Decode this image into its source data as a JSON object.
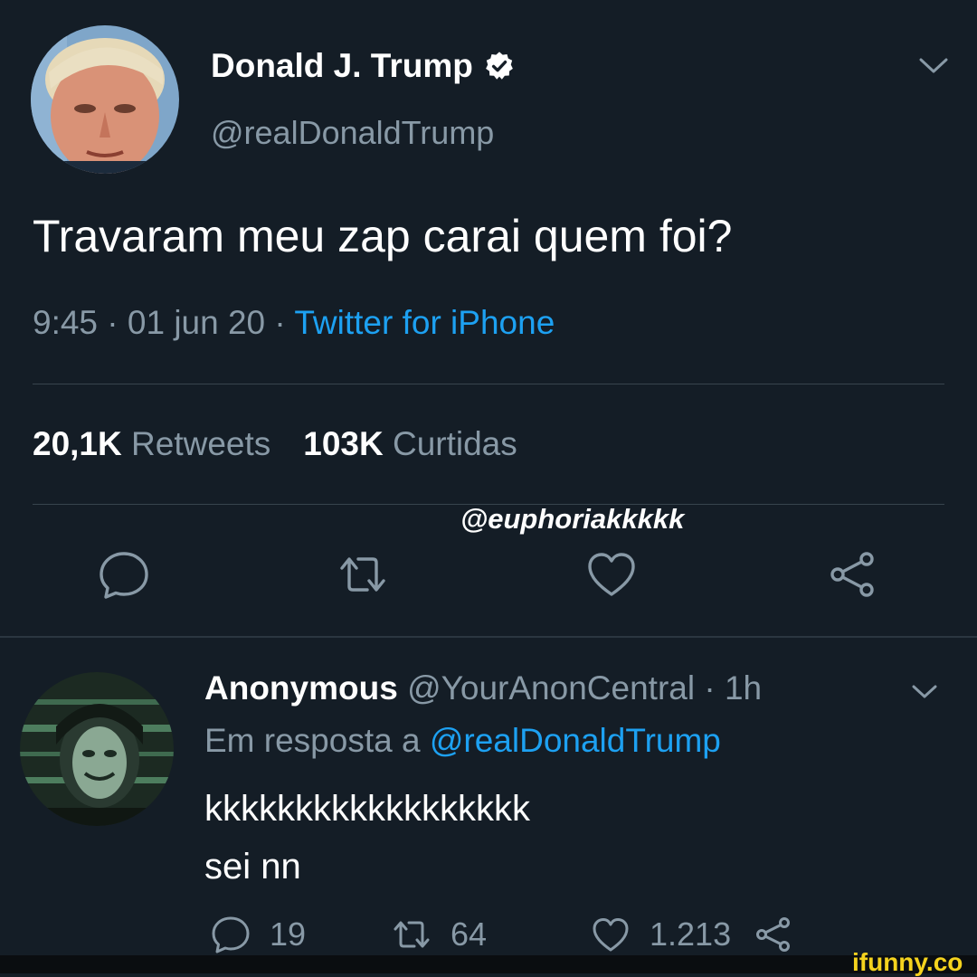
{
  "tweet": {
    "author_name": "Donald J. Trump",
    "author_handle": "@realDonaldTrump",
    "text": "Travaram meu zap carai quem foi?",
    "time_date": "9:45 · 01 jun 20 · ",
    "source": "Twitter for iPhone",
    "retweets_count": "20,1K",
    "retweets_label": "Retweets",
    "likes_count": "103K",
    "likes_label": "Curtidas",
    "icons": [
      "reply-icon",
      "retweet-icon",
      "like-icon",
      "share-icon"
    ]
  },
  "watermark": {
    "username": "@euphoriakkkkk",
    "site": "ifunny.co"
  },
  "reply": {
    "author_name": "Anonymous",
    "author_handle": "@YourAnonCentral · 1h",
    "reply_prefix": "Em resposta a ",
    "reply_to": "@realDonaldTrump",
    "text_line1": "kkkkkkkkkkkkkkkkkk",
    "text_line2": "sei nn",
    "reply_count": "19",
    "retweet_count": "64",
    "like_count": "1.213"
  },
  "colors": {
    "background": "#141d26",
    "secondary_text": "#8899a6",
    "link": "#1da1f2",
    "watermark": "#f5d31e"
  }
}
